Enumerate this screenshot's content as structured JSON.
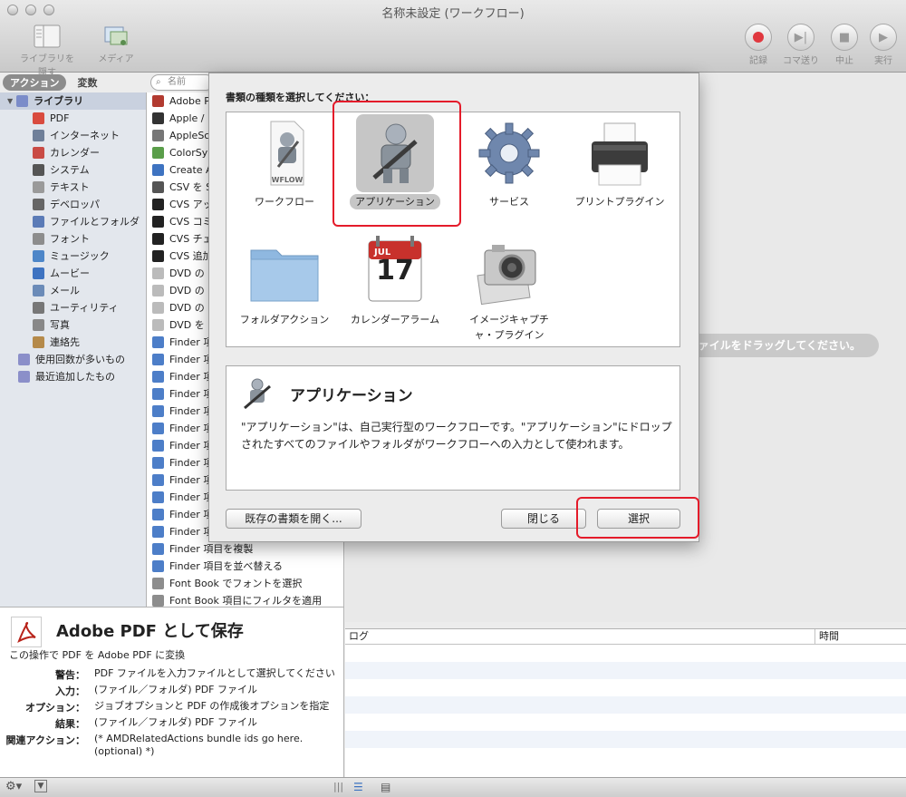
{
  "window": {
    "title": "名称未設定 (ワークフロー)"
  },
  "toolbar": {
    "hide_library": "ライブラリを隠す",
    "media": "メディア",
    "record": "記録",
    "step": "コマ送り",
    "stop": "中止",
    "run": "実行"
  },
  "library": {
    "tab_actions": "アクション",
    "tab_variables": "変数",
    "search_placeholder": "名前",
    "items": [
      {
        "label": "ライブラリ",
        "icon": "library-icon",
        "color": "#7b8cc9"
      },
      {
        "label": "PDF",
        "icon": "pdf-icon",
        "color": "#d94b3f"
      },
      {
        "label": "インターネット",
        "icon": "internet-icon",
        "color": "#6f7f99"
      },
      {
        "label": "カレンダー",
        "icon": "calendar-icon",
        "color": "#c94b45"
      },
      {
        "label": "システム",
        "icon": "system-icon",
        "color": "#555555"
      },
      {
        "label": "テキスト",
        "icon": "text-icon",
        "color": "#9a9a9a"
      },
      {
        "label": "デベロッパ",
        "icon": "developer-icon",
        "color": "#666666"
      },
      {
        "label": "ファイルとフォルダ",
        "icon": "folder-icon",
        "color": "#5b7bb7"
      },
      {
        "label": "フォント",
        "icon": "font-icon",
        "color": "#8d8d8d"
      },
      {
        "label": "ミュージック",
        "icon": "music-icon",
        "color": "#4d86c8"
      },
      {
        "label": "ムービー",
        "icon": "movie-icon",
        "color": "#3e73c1"
      },
      {
        "label": "メール",
        "icon": "mail-icon",
        "color": "#6b8bb8"
      },
      {
        "label": "ユーティリティ",
        "icon": "utility-icon",
        "color": "#777777"
      },
      {
        "label": "写真",
        "icon": "photo-icon",
        "color": "#888888"
      },
      {
        "label": "連絡先",
        "icon": "contacts-icon",
        "color": "#b58a4a"
      },
      {
        "label": "使用回数が多いもの",
        "icon": "smart-folder-icon",
        "color": "#8b8fc9"
      },
      {
        "label": "最近追加したもの",
        "icon": "smart-folder-icon",
        "color": "#8b8fc9"
      }
    ]
  },
  "actions": [
    {
      "label": "Adobe P",
      "color": "#b23a30"
    },
    {
      "label": "Apple /",
      "color": "#333333"
    },
    {
      "label": "AppleSc",
      "color": "#777777"
    },
    {
      "label": "ColorSy",
      "color": "#5a9e4a"
    },
    {
      "label": "Create A",
      "color": "#3e73c1"
    },
    {
      "label": "CSV を S",
      "color": "#555555"
    },
    {
      "label": "CVS アッ",
      "color": "#222222"
    },
    {
      "label": "CVS コミ",
      "color": "#222222"
    },
    {
      "label": "CVS チェ",
      "color": "#222222"
    },
    {
      "label": "CVS 追加",
      "color": "#222222"
    },
    {
      "label": "DVD の",
      "color": "#bbbbbb"
    },
    {
      "label": "DVD の",
      "color": "#bbbbbb"
    },
    {
      "label": "DVD の",
      "color": "#bbbbbb"
    },
    {
      "label": "DVD を",
      "color": "#bbbbbb"
    },
    {
      "label": "Finder 項",
      "color": "#4d7ec8"
    },
    {
      "label": "Finder 項",
      "color": "#4d7ec8"
    },
    {
      "label": "Finder 項",
      "color": "#4d7ec8"
    },
    {
      "label": "Finder 項",
      "color": "#4d7ec8"
    },
    {
      "label": "Finder 項",
      "color": "#4d7ec8"
    },
    {
      "label": "Finder 項",
      "color": "#4d7ec8"
    },
    {
      "label": "Finder 項",
      "color": "#4d7ec8"
    },
    {
      "label": "Finder 項",
      "color": "#4d7ec8"
    },
    {
      "label": "Finder 項",
      "color": "#4d7ec8"
    },
    {
      "label": "Finder 項",
      "color": "#4d7ec8"
    },
    {
      "label": "Finder 項",
      "color": "#4d7ec8"
    },
    {
      "label": "Finder 項",
      "color": "#4d7ec8"
    },
    {
      "label": "Finder 項目を複製",
      "color": "#4d7ec8"
    },
    {
      "label": "Finder 項目を並べ替える",
      "color": "#4d7ec8"
    },
    {
      "label": "Font Book でフォントを選択",
      "color": "#8d8d8d"
    },
    {
      "label": "Font Book 項目にフィルタを適用",
      "color": "#8d8d8d"
    }
  ],
  "description": {
    "title": "Adobe PDF として保存",
    "subtitle": "この操作で PDF を Adobe PDF に変換",
    "rows": [
      {
        "key": "警告：",
        "value": "PDF ファイルを入力ファイルとして選択してください"
      },
      {
        "key": "入力：",
        "value": "(ファイル／フォルダ) PDF ファイル"
      },
      {
        "key": "オプション：",
        "value": "ジョブオプションと PDF の作成後オプションを指定"
      },
      {
        "key": "結果：",
        "value": "(ファイル／フォルダ) PDF ファイル"
      },
      {
        "key": "関連アクション：",
        "value": "(* AMDRelatedActions bundle ids go here. (optional) *)"
      }
    ]
  },
  "workflow": {
    "drag_hint": "ァイルをドラッグしてください。"
  },
  "log": {
    "col_log": "ログ",
    "col_time": "時間"
  },
  "sheet": {
    "prompt": "書類の種類を選択してください：",
    "types": [
      {
        "label": "ワークフロー",
        "icon": "workflow-icon",
        "badge": "WFLOW"
      },
      {
        "label": "アプリケーション",
        "icon": "application-icon",
        "selected": true
      },
      {
        "label": "サービス",
        "icon": "service-gear-icon"
      },
      {
        "label": "プリントプラグイン",
        "icon": "printer-icon"
      },
      {
        "label": "フォルダアクション",
        "icon": "folder-action-icon"
      },
      {
        "label": "カレンダーアラーム",
        "icon": "calendar-alarm-icon",
        "month": "JUL",
        "day": "17"
      },
      {
        "label": "イメージキャプチャ・プラグイン",
        "icon": "camera-icon"
      }
    ],
    "info_title": "アプリケーション",
    "info_text": "\"アプリケーション\"は、自己実行型のワークフローです。\"アプリケーション\"にドロップされたすべてのファイルやフォルダがワークフローへの入力として使われます。",
    "open_existing": "既存の書類を開く...",
    "close": "閉じる",
    "choose": "選択"
  },
  "colors": {
    "highlight_red": "#e41b2a",
    "selection_gray": "#c6c6c6"
  }
}
